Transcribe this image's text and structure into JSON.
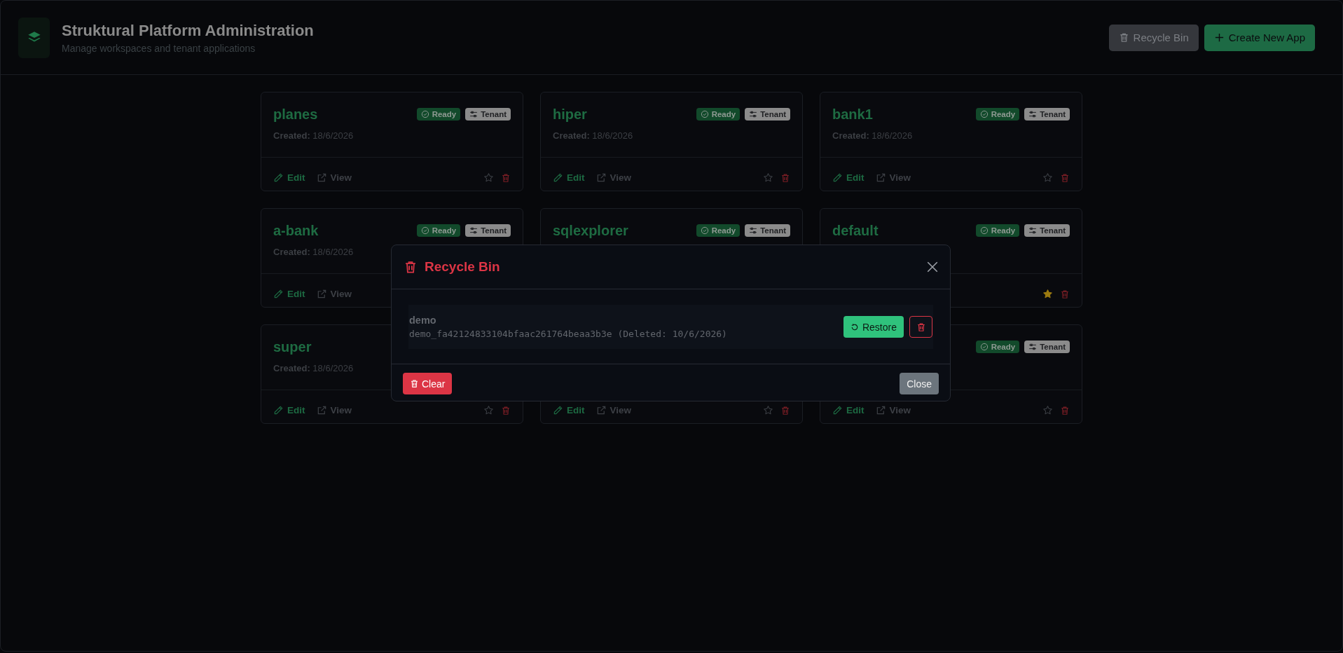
{
  "header": {
    "title": "Struktural Platform Administration",
    "subtitle": "Manage workspaces and tenant applications",
    "buttons": [
      {
        "label": "Recycle Bin",
        "kind": "recycle"
      },
      {
        "label": "Create New App",
        "kind": "create"
      }
    ]
  },
  "apps": [
    {
      "name": "planes",
      "badges": [
        {
          "label": "Ready",
          "kind": "status"
        },
        {
          "label": "Tenant",
          "kind": "type"
        }
      ],
      "created_label": "Created:",
      "created_date": "18/6/2026",
      "actions": [
        {
          "label": "Edit",
          "kind": "edit"
        },
        {
          "label": "View",
          "kind": "view"
        }
      ],
      "starred": false
    },
    {
      "name": "hiper",
      "badges": [
        {
          "label": "Ready",
          "kind": "status"
        },
        {
          "label": "Tenant",
          "kind": "type"
        }
      ],
      "created_label": "Created:",
      "created_date": "18/6/2026",
      "actions": [
        {
          "label": "Edit",
          "kind": "edit"
        },
        {
          "label": "View",
          "kind": "view"
        }
      ],
      "starred": false
    },
    {
      "name": "bank1",
      "badges": [
        {
          "label": "Ready",
          "kind": "status"
        },
        {
          "label": "Tenant",
          "kind": "type"
        }
      ],
      "created_label": "Created:",
      "created_date": "18/6/2026",
      "actions": [
        {
          "label": "Edit",
          "kind": "edit"
        },
        {
          "label": "View",
          "kind": "view"
        }
      ],
      "starred": false
    },
    {
      "name": "a-bank",
      "badges": [
        {
          "label": "Ready",
          "kind": "status"
        },
        {
          "label": "Tenant",
          "kind": "type"
        }
      ],
      "created_label": "Created:",
      "created_date": "18/6/2026",
      "actions": [
        {
          "label": "Edit",
          "kind": "edit"
        },
        {
          "label": "View",
          "kind": "view"
        }
      ]
    },
    {
      "name": "sqlexplorer",
      "badges": [
        {
          "label": "Ready",
          "kind": "status"
        },
        {
          "label": "Tenant",
          "kind": "type"
        }
      ]
    },
    {
      "name": "default",
      "badges": [
        {
          "label": "Ready",
          "kind": "status"
        },
        {
          "label": "Tenant",
          "kind": "type"
        }
      ],
      "starred": true
    },
    {
      "name": "super",
      "created_label": "Created:",
      "created_date": "18/6/2026",
      "actions": [
        {
          "label": "Edit",
          "kind": "edit"
        },
        {
          "label": "View",
          "kind": "view"
        }
      ],
      "starred": false
    },
    {
      "actions": [
        {
          "label": "Edit",
          "kind": "edit"
        },
        {
          "label": "View",
          "kind": "view"
        }
      ],
      "starred": false
    },
    {
      "badges": [
        {
          "label": "Ready",
          "kind": "status"
        },
        {
          "label": "Tenant",
          "kind": "type"
        }
      ],
      "actions": [
        {
          "label": "Edit",
          "kind": "edit"
        },
        {
          "label": "View",
          "kind": "view"
        }
      ],
      "starred": false
    }
  ],
  "modal": {
    "title": "Recycle Bin",
    "items": [
      {
        "name": "demo",
        "detail": "demo_fa42124833104bfaac261764beaa3b3e (Deleted: 10/6/2026)",
        "restore_label": "Restore"
      }
    ],
    "clear_label": "Clear",
    "close_label": "Close"
  }
}
